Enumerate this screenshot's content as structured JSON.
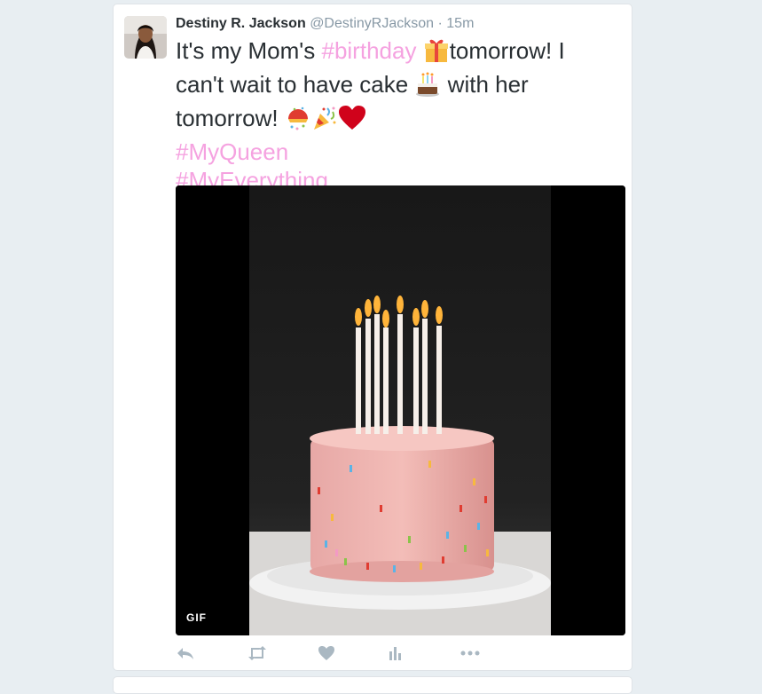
{
  "tweet": {
    "display_name": "Destiny R. Jackson",
    "handle": "@DestinyRJackson",
    "separator": "·",
    "time": "15m",
    "text_part1": "It's my Mom's ",
    "hashtag_birthday": "#birthday",
    "text_part2": "tomorrow! I can't wait to have cake ",
    "text_part3": " with her tomorrow! ",
    "hashtag_queen": "#MyQueen",
    "hashtag_everything": "#MyEverything",
    "emojis": [
      "gift-emoji",
      "birthday-cake-emoji",
      "confetti-ball-emoji",
      "party-popper-emoji",
      "red-heart-emoji"
    ]
  },
  "media": {
    "badge": "GIF",
    "subject": "birthday-cake-with-candles"
  },
  "actions": [
    "reply-icon",
    "retweet-icon",
    "like-icon",
    "analytics-icon",
    "more-icon"
  ],
  "colors": {
    "hashtag": "#f5a2e0",
    "text": "#292f33",
    "meta": "#8899a6",
    "action_icon": "#aab8c2"
  }
}
